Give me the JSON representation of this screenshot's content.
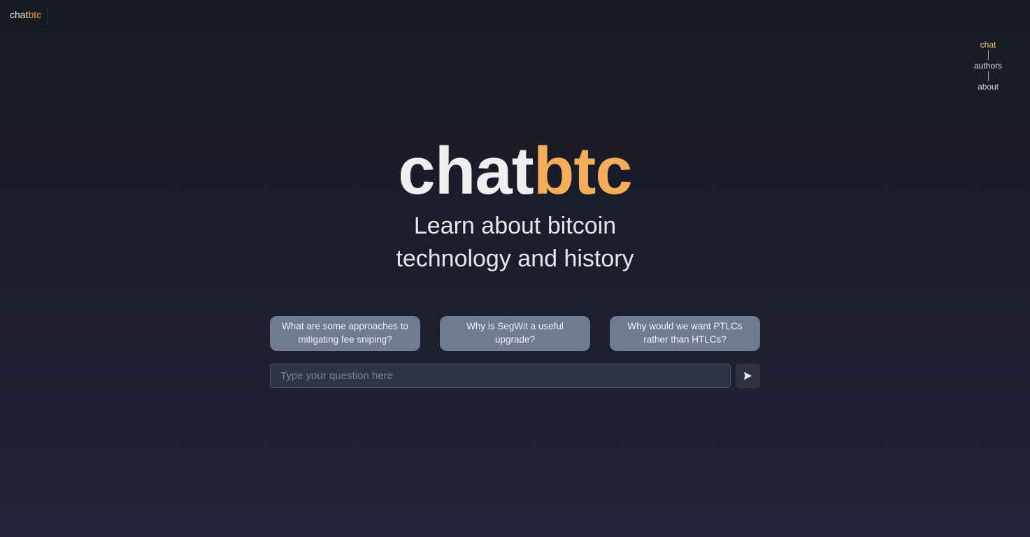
{
  "header": {
    "brand_chat": "chat",
    "brand_btc": "btc"
  },
  "nav": {
    "items": [
      {
        "label": "chat",
        "active": true
      },
      {
        "label": "authors",
        "active": false
      },
      {
        "label": "about",
        "active": false
      }
    ]
  },
  "hero": {
    "title_chat": "chat",
    "title_btc": "btc",
    "subtitle_line1": "Learn about bitcoin",
    "subtitle_line2": "technology and history"
  },
  "suggestions": [
    "What are some approaches to mitigating fee sniping?",
    "Why is SegWit a useful upgrade?",
    "Why would we want PTLCs rather than HTLCs?"
  ],
  "question_input": {
    "placeholder": "Type your question here",
    "value": ""
  },
  "send_button": {
    "icon": "send-icon"
  },
  "colors": {
    "accent_orange": "#f4ad5b",
    "nav_active": "#f4c37c",
    "suggestion_bg": "#6f7b92",
    "background_top": "#191b24",
    "background_bottom": "#22223a"
  }
}
